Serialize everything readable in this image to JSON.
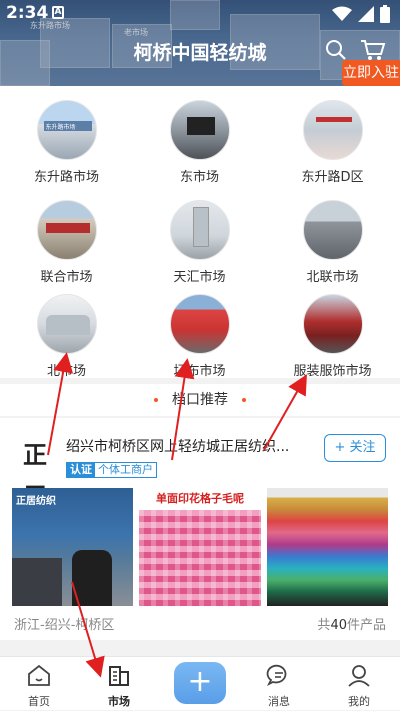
{
  "status": {
    "time": "2:34",
    "notif": "A"
  },
  "header": {
    "title": "柯桥中国轻纺城",
    "join_label": "立即入驻",
    "banner_sign1": "东升路市场",
    "banner_sign2": "老市场"
  },
  "markets": [
    {
      "label": "东升路市场",
      "thumb_text": "东升路市场"
    },
    {
      "label": "东市场"
    },
    {
      "label": "东升路D区"
    },
    {
      "label": "联合市场"
    },
    {
      "label": "天汇市场"
    },
    {
      "label": "北联市场"
    },
    {
      "label": "北市场"
    },
    {
      "label": "坯布市场"
    },
    {
      "label": "服装服饰市场"
    }
  ],
  "section": {
    "title": "档口推荐"
  },
  "shop": {
    "logo": "正居",
    "name": "绍兴市柯桥区网上轻纺城正居纺织...",
    "badge_verify": "认证",
    "badge_type": "个体工商户",
    "follow_label": "+ 关注",
    "location": "浙江-绍兴-柯桥区",
    "count_prefix": "共",
    "count_value": "40",
    "count_suffix": "件产品",
    "product1_brand": "正居纺织",
    "product2_caption": "单面印花格子毛呢"
  },
  "tabs": [
    {
      "label": "首页"
    },
    {
      "label": "市场"
    },
    {
      "label": "+"
    },
    {
      "label": "消息"
    },
    {
      "label": "我的"
    }
  ],
  "colors": {
    "accent": "#f05a22",
    "blue": "#2a8fd8",
    "annotation": "#e02020"
  }
}
